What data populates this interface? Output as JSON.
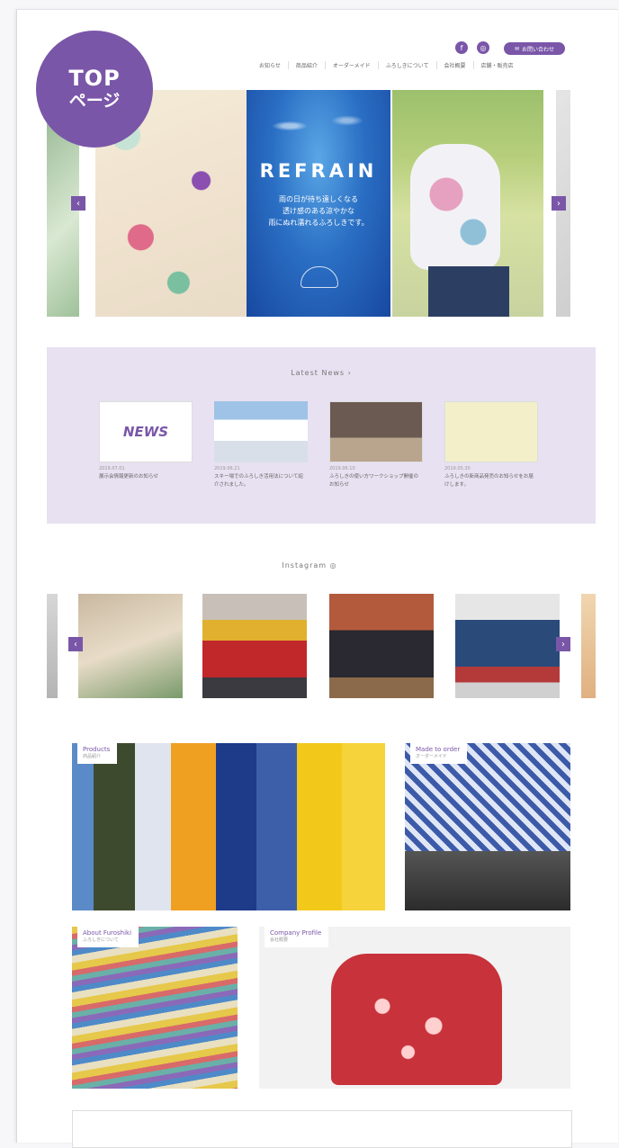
{
  "badge": {
    "line1": "TOP",
    "line2": "ページ"
  },
  "header": {
    "logo_sub": "k",
    "social": [
      {
        "icon": "facebook-icon",
        "label": "f"
      },
      {
        "icon": "instagram-icon",
        "label": "◎"
      }
    ],
    "contact": {
      "icon": "mail-icon",
      "label": "お問い合わせ"
    },
    "nav": [
      "お知らせ",
      "商品紹介",
      "オーダーメイド",
      "ふろしきについて",
      "会社概要",
      "店舗・販売店"
    ]
  },
  "hero": {
    "slides": [
      "left-edge",
      "flowers",
      "refrain",
      "bag",
      "right-edge"
    ],
    "refrain_title": "REFRAIN",
    "refrain_copy": [
      "雨の日が待ち遠しくなる",
      "透け感のある涼やかな",
      "雨にぬれ濡れるふろしきです。"
    ],
    "colors": {
      "accent": "#7a56a8",
      "news_bg": "#e7e1f1"
    }
  },
  "news": {
    "title": "Latest News ›",
    "items": [
      {
        "thumb_text": "NEWS",
        "date": "2019.07.01",
        "text": "展示会情報更新のお知らせ"
      },
      {
        "thumb_text": "",
        "date": "2019.06.21",
        "text": "スキー場でのふろしき活用法について紹介されました。"
      },
      {
        "thumb_text": "",
        "date": "2019.06.10",
        "text": "ふろしきの使い方ワークショップ開催のお知らせ"
      },
      {
        "thumb_text": "",
        "date": "2019.05.30",
        "text": "ふろしきの新商品発売のお知らせをお届けします。"
      }
    ]
  },
  "instagram": {
    "title": "Instagram ◎"
  },
  "categories": [
    {
      "title": "Products",
      "sub": "商品紹介"
    },
    {
      "title": "Made to order",
      "sub": "オーダーメイド"
    },
    {
      "title": "About Furoshiki",
      "sub": "ふろしきについて"
    },
    {
      "title": "Company Profile",
      "sub": "会社概要"
    }
  ]
}
